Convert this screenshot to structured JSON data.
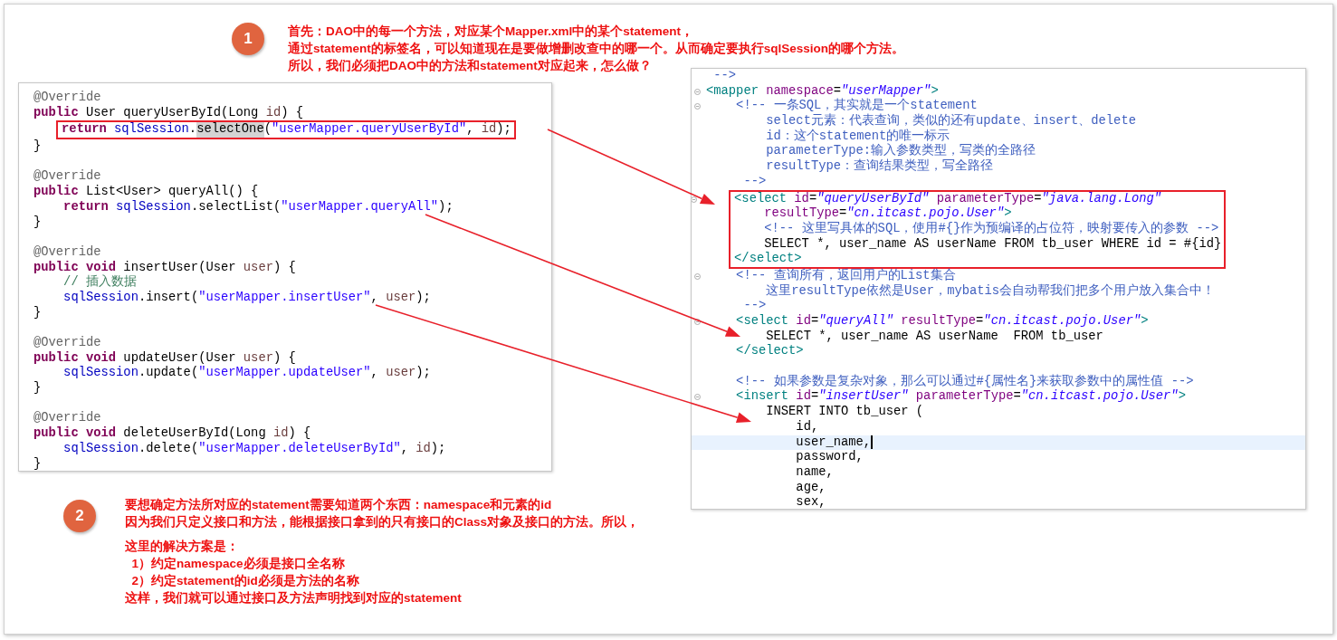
{
  "note_top": {
    "badge": "1",
    "lines": [
      "首先：DAO中的每一个方法，对应某个Mapper.xml中的某个statement，",
      "通过statement的标签名，可以知道现在是要做增删改查中的哪一个。从而确定要执行sqlSession的哪个方法。",
      "所以，我们必须把DAO中的方法和statement对应起来，怎么做？"
    ]
  },
  "java_editor": {
    "lines": [
      {
        "segments": [
          {
            "text": "@Override",
            "kind": "annotation"
          }
        ]
      },
      {
        "segments": [
          {
            "text": "public",
            "kind": "keyword"
          },
          {
            "text": " User queryUserById(Long ",
            "kind": "plain"
          },
          {
            "text": "id",
            "kind": "param"
          },
          {
            "text": ") {",
            "kind": "plain"
          }
        ]
      },
      {
        "boxed": true,
        "segments": [
          {
            "text": "    return ",
            "kind": "keyword"
          },
          {
            "text": "sqlSession",
            "kind": "field"
          },
          {
            "text": ".",
            "kind": "plain"
          },
          {
            "text": "selectOne",
            "kind": "occurrence"
          },
          {
            "text": "(",
            "kind": "plain"
          },
          {
            "text": "\"userMapper.queryUserById\"",
            "kind": "string"
          },
          {
            "text": ", ",
            "kind": "plain"
          },
          {
            "text": "id",
            "kind": "param"
          },
          {
            "text": ");",
            "kind": "plain"
          }
        ]
      },
      {
        "segments": [
          {
            "text": "}",
            "kind": "plain"
          }
        ]
      },
      {
        "blank_before": true,
        "segments": [
          {
            "text": "@Override",
            "kind": "annotation"
          }
        ]
      },
      {
        "segments": [
          {
            "text": "public",
            "kind": "keyword"
          },
          {
            "text": " List<User> queryAll() {",
            "kind": "plain"
          }
        ]
      },
      {
        "segments": [
          {
            "text": "    return ",
            "kind": "keyword"
          },
          {
            "text": "sqlSession",
            "kind": "field"
          },
          {
            "text": ".selectList(",
            "kind": "plain"
          },
          {
            "text": "\"userMapper.queryAll\"",
            "kind": "string"
          },
          {
            "text": ");",
            "kind": "plain"
          }
        ]
      },
      {
        "segments": [
          {
            "text": "}",
            "kind": "plain"
          }
        ]
      },
      {
        "blank_before": true,
        "segments": [
          {
            "text": "@Override",
            "kind": "annotation"
          }
        ]
      },
      {
        "segments": [
          {
            "text": "public void",
            "kind": "keyword"
          },
          {
            "text": " insertUser(User ",
            "kind": "plain"
          },
          {
            "text": "user",
            "kind": "param"
          },
          {
            "text": ") {",
            "kind": "plain"
          }
        ]
      },
      {
        "segments": [
          {
            "text": "    // 插入数据",
            "kind": "comment"
          }
        ]
      },
      {
        "segments": [
          {
            "text": "    sqlSession",
            "kind": "field"
          },
          {
            "text": ".insert(",
            "kind": "plain"
          },
          {
            "text": "\"userMapper.insertUser\"",
            "kind": "string"
          },
          {
            "text": ", ",
            "kind": "plain"
          },
          {
            "text": "user",
            "kind": "param"
          },
          {
            "text": ");",
            "kind": "plain"
          }
        ]
      },
      {
        "segments": [
          {
            "text": "}",
            "kind": "plain"
          }
        ]
      },
      {
        "blank_before": true,
        "segments": [
          {
            "text": "@Override",
            "kind": "annotation"
          }
        ]
      },
      {
        "segments": [
          {
            "text": "public void",
            "kind": "keyword"
          },
          {
            "text": " updateUser(User ",
            "kind": "plain"
          },
          {
            "text": "user",
            "kind": "param"
          },
          {
            "text": ") {",
            "kind": "plain"
          }
        ]
      },
      {
        "segments": [
          {
            "text": "    sqlSession",
            "kind": "field"
          },
          {
            "text": ".update(",
            "kind": "plain"
          },
          {
            "text": "\"userMapper.updateUser\"",
            "kind": "string"
          },
          {
            "text": ", ",
            "kind": "plain"
          },
          {
            "text": "user",
            "kind": "param"
          },
          {
            "text": ");",
            "kind": "plain"
          }
        ]
      },
      {
        "segments": [
          {
            "text": "}",
            "kind": "plain"
          }
        ]
      },
      {
        "blank_before": true,
        "segments": [
          {
            "text": "@Override",
            "kind": "annotation"
          }
        ]
      },
      {
        "segments": [
          {
            "text": "public void",
            "kind": "keyword"
          },
          {
            "text": " deleteUserById(Long ",
            "kind": "plain"
          },
          {
            "text": "id",
            "kind": "param"
          },
          {
            "text": ") {",
            "kind": "plain"
          }
        ]
      },
      {
        "segments": [
          {
            "text": "    sqlSession",
            "kind": "field"
          },
          {
            "text": ".delete(",
            "kind": "plain"
          },
          {
            "text": "\"userMapper.deleteUserById\"",
            "kind": "string"
          },
          {
            "text": ", ",
            "kind": "plain"
          },
          {
            "text": "id",
            "kind": "param"
          },
          {
            "text": ");",
            "kind": "plain"
          }
        ]
      },
      {
        "segments": [
          {
            "text": "}",
            "kind": "plain"
          }
        ]
      }
    ]
  },
  "xml_editor": {
    "lines": [
      {
        "segments": [
          {
            "text": " -->",
            "kind": "xcomment"
          }
        ]
      },
      {
        "fold": true,
        "segments": [
          {
            "text": "<mapper",
            "kind": "tag"
          },
          {
            "text": " namespace",
            "kind": "attr"
          },
          {
            "text": "=",
            "kind": "plain"
          },
          {
            "text": "\"userMapper\"",
            "kind": "value"
          },
          {
            "text": ">",
            "kind": "tag"
          }
        ]
      },
      {
        "fold": true,
        "segments": [
          {
            "text": "    <!-- 一条SQL，其实就是一个statement",
            "kind": "xcomment"
          }
        ]
      },
      {
        "segments": [
          {
            "text": "        select元素：代表查询，类似的还有update、insert、delete",
            "kind": "xcomment"
          }
        ]
      },
      {
        "segments": [
          {
            "text": "        id：这个statement的唯一标示",
            "kind": "xcomment"
          }
        ]
      },
      {
        "segments": [
          {
            "text": "        parameterType:输入参数类型，写类的全路径",
            "kind": "xcomment"
          }
        ]
      },
      {
        "segments": [
          {
            "text": "        resultType：查询结果类型，写全路径",
            "kind": "xcomment"
          }
        ]
      },
      {
        "segments": [
          {
            "text": "     -->",
            "kind": "xcomment"
          }
        ]
      },
      {
        "fold": true,
        "boxed": true,
        "segments": [
          {
            "text": "    <select",
            "kind": "tag"
          },
          {
            "text": " id",
            "kind": "attr"
          },
          {
            "text": "=",
            "kind": "plain"
          },
          {
            "text": "\"queryUserById\"",
            "kind": "value"
          },
          {
            "text": " parameterType",
            "kind": "attr"
          },
          {
            "text": "=",
            "kind": "plain"
          },
          {
            "text": "\"java.lang.Long\"",
            "kind": "value"
          }
        ]
      },
      {
        "boxed": true,
        "segments": [
          {
            "text": "        resultType",
            "kind": "attr"
          },
          {
            "text": "=",
            "kind": "plain"
          },
          {
            "text": "\"cn.itcast.pojo.User\"",
            "kind": "value"
          },
          {
            "text": ">",
            "kind": "tag"
          }
        ]
      },
      {
        "boxed": true,
        "segments": [
          {
            "text": "        <!-- 这里写具体的SQL，使用#{}作为预编译的占位符，映射要传入的参数 -->",
            "kind": "xcomment"
          }
        ]
      },
      {
        "boxed": true,
        "segments": [
          {
            "text": "        SELECT *, user_name AS userName FROM tb_user WHERE id = #{id}",
            "kind": "plain"
          }
        ]
      },
      {
        "boxed": true,
        "segments": [
          {
            "text": "    </select>",
            "kind": "tag"
          }
        ]
      },
      {
        "fold": true,
        "segments": [
          {
            "text": "    <!-- 查询所有，返回用户的List集合",
            "kind": "xcomment"
          }
        ]
      },
      {
        "segments": [
          {
            "text": "        这里resultType依然是User，mybatis会自动帮我们把多个用户放入集合中！",
            "kind": "xcomment"
          }
        ]
      },
      {
        "segments": [
          {
            "text": "     -->",
            "kind": "xcomment"
          }
        ]
      },
      {
        "fold": true,
        "segments": [
          {
            "text": "    <select",
            "kind": "tag"
          },
          {
            "text": " id",
            "kind": "attr"
          },
          {
            "text": "=",
            "kind": "plain"
          },
          {
            "text": "\"queryAll\"",
            "kind": "value"
          },
          {
            "text": " resultType",
            "kind": "attr"
          },
          {
            "text": "=",
            "kind": "plain"
          },
          {
            "text": "\"cn.itcast.pojo.User\"",
            "kind": "value"
          },
          {
            "text": ">",
            "kind": "tag"
          }
        ]
      },
      {
        "segments": [
          {
            "text": "        SELECT *, user_name AS userName  FROM tb_user",
            "kind": "plain"
          }
        ]
      },
      {
        "segments": [
          {
            "text": "    </select>",
            "kind": "tag"
          }
        ]
      },
      {
        "blank_before": true,
        "segments": [
          {
            "text": "    <!-- 如果参数是复杂对象，那么可以通过#{属性名}来获取参数中的属性值 -->",
            "kind": "xcomment"
          }
        ]
      },
      {
        "fold": true,
        "segments": [
          {
            "text": "    <insert",
            "kind": "tag"
          },
          {
            "text": " id",
            "kind": "attr"
          },
          {
            "text": "=",
            "kind": "plain"
          },
          {
            "text": "\"insertUser\"",
            "kind": "value"
          },
          {
            "text": " parameterType",
            "kind": "attr"
          },
          {
            "text": "=",
            "kind": "plain"
          },
          {
            "text": "\"cn.itcast.pojo.User\"",
            "kind": "value"
          },
          {
            "text": ">",
            "kind": "tag"
          }
        ]
      },
      {
        "segments": [
          {
            "text": "        INSERT INTO tb_user (",
            "kind": "plain"
          }
        ]
      },
      {
        "segments": [
          {
            "text": "            id,",
            "kind": "plain"
          }
        ]
      },
      {
        "current": true,
        "segments": [
          {
            "text": "            user_name,",
            "kind": "plain"
          }
        ]
      },
      {
        "segments": [
          {
            "text": "            password,",
            "kind": "plain"
          }
        ]
      },
      {
        "segments": [
          {
            "text": "            name,",
            "kind": "plain"
          }
        ]
      },
      {
        "segments": [
          {
            "text": "            age,",
            "kind": "plain"
          }
        ]
      },
      {
        "segments": [
          {
            "text": "            sex,",
            "kind": "plain"
          }
        ]
      }
    ]
  },
  "note_bottom": {
    "badge": "2",
    "paragraphs": [
      [
        "要想确定方法所对应的statement需要知道两个东西：namespace和元素的id",
        "因为我们只定义接口和方法，能根据接口拿到的只有接口的Class对象及接口的方法。所以，"
      ],
      [
        "这里的解决方案是：",
        "  1）约定namespace必须是接口全名称",
        "  2）约定statement的id必须是方法的名称",
        "这样，我们就可以通过接口及方法声明找到对应的statement"
      ]
    ]
  }
}
